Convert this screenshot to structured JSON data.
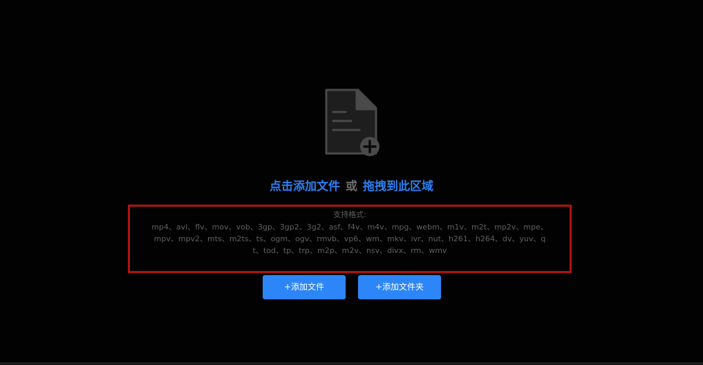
{
  "dropzone": {
    "icon": "add-file-icon",
    "headline": {
      "click_text": "点击添加文件",
      "or_text": "或",
      "drag_text": "拖拽到此区域"
    },
    "formats": {
      "title": "支持格式:",
      "list": "mp4、avi、flv、mov、vob、3gp、3gp2、3g2、asf、f4v、m4v、mpg、webm、m1v、m2t、mp2v、mpe、mpv、mpv2、mts、m2ts、ts、ogm、ogv、rmvb、vp6、wm、mkv、ivr、nut、h261、h264、dv、yuv、qt、tod、tp、trp、m2p、m2v、nsv、divx、rm、wmv"
    }
  },
  "buttons": {
    "add_file_label": "+添加文件",
    "add_folder_label": "+添加文件夹"
  },
  "colors": {
    "accent": "#2c86f7",
    "link": "#2f7ef0",
    "highlight_border": "#b0140e",
    "muted_text": "#606060",
    "icon_gray": "#4a4a4a"
  }
}
